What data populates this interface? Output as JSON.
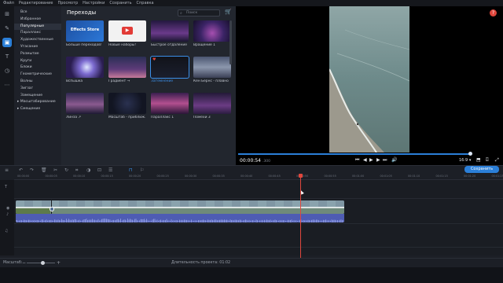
{
  "menu": [
    "Файл",
    "Редактирование",
    "Просмотр",
    "Настройки",
    "Сохранить",
    "Справка"
  ],
  "sidebar_icons": [
    "import-icon",
    "pin-icon",
    "transitions-icon",
    "titles-icon",
    "clock-icon",
    "more-icon"
  ],
  "categories": [
    {
      "label": "Все"
    },
    {
      "label": "Избранное"
    },
    {
      "label": "Популярные",
      "active": true
    },
    {
      "label": "Параллакс"
    },
    {
      "label": "Художественные"
    },
    {
      "label": "Угасание"
    },
    {
      "label": "Размытие"
    },
    {
      "label": "Круги"
    },
    {
      "label": "Блоки"
    },
    {
      "label": "Геометрические"
    },
    {
      "label": "Волны"
    },
    {
      "label": "Зигзаг"
    },
    {
      "label": "Замещение"
    },
    {
      "label": "▸ Масштабирование",
      "expandable": true
    },
    {
      "label": "▸ Смещение",
      "expandable": true
    }
  ],
  "panel": {
    "title": "Переходы",
    "search_placeholder": "Поиск",
    "tiles": [
      {
        "label": "Больше переходов!",
        "thumb_text": "Effects Store"
      },
      {
        "label": "Новые наборы!"
      },
      {
        "label": "Быстрое отдаление"
      },
      {
        "label": "Вращение 1"
      },
      {
        "label": "Вспышка"
      },
      {
        "label": "Градиент →"
      },
      {
        "label": "Затемнение",
        "selected": true
      },
      {
        "label": "Кен Бернс - плавно"
      },
      {
        "label": "Линза ↗"
      },
      {
        "label": "Масштаб - приближ."
      },
      {
        "label": "Параллакс 1"
      },
      {
        "label": "Помехи 3"
      }
    ]
  },
  "player": {
    "time": "00:00:54",
    "time_ms": ".300",
    "aspect": "16:9",
    "progress_fraction": 0.98
  },
  "export": {
    "label": "Сохранить"
  },
  "ruler": [
    "00:00:00",
    "00:00:05",
    "00:00:10",
    "00:00:15",
    "00:00:20",
    "00:00:25",
    "00:00:30",
    "00:00:35",
    "00:00:40",
    "00:00:45",
    "00:00:50",
    "00:00:55",
    "00:01:00",
    "00:01:05",
    "00:01:10",
    "00:01:15",
    "00:01:20",
    "00:01:25"
  ],
  "status": {
    "zoom_label": "Масштаб:",
    "duration": "Длительность проекта: 01:02"
  },
  "colors": {
    "accent": "#2b7fd8",
    "playhead": "#e0473d",
    "video_clip": "#4c6b8f",
    "audio_clip": "#4e5cb3"
  }
}
